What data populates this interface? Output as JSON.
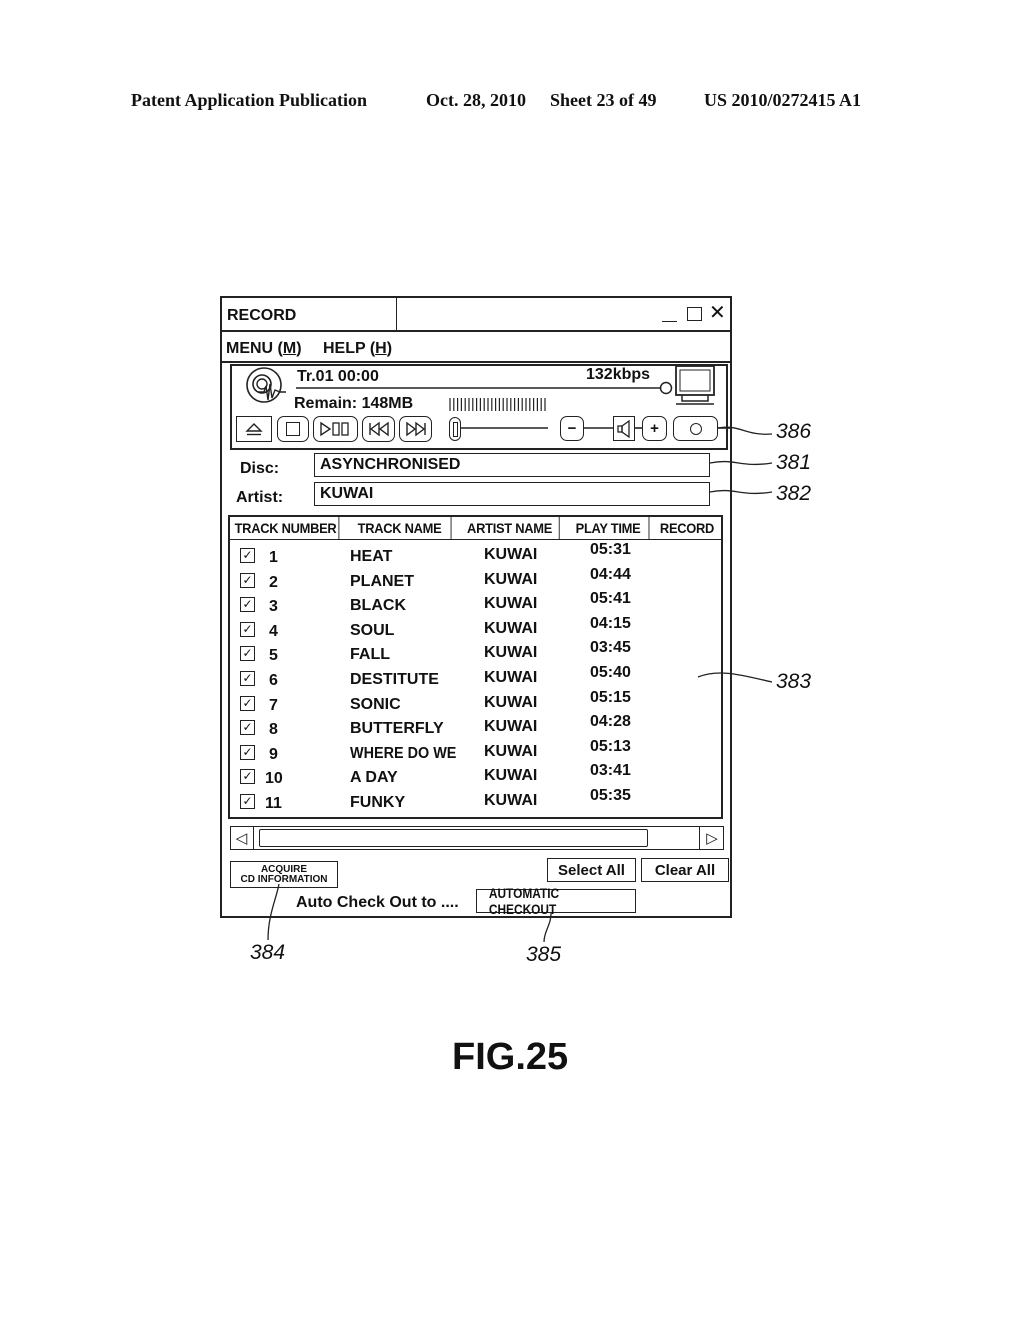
{
  "page_header": {
    "publication": "Patent Application Publication",
    "date": "Oct. 28, 2010",
    "sheet": "Sheet 23 of 49",
    "patent_number": "US 2010/0272415 A1"
  },
  "window": {
    "title": "RECORD",
    "controls": {
      "minimize": "_",
      "maximize": "□",
      "close": "✕"
    },
    "menu": [
      {
        "label": "MENU (",
        "mnemonic": "M",
        "suffix": ")"
      },
      {
        "label": "HELP (",
        "mnemonic": "H",
        "suffix": ")"
      }
    ]
  },
  "player": {
    "track_time": "Tr.01  00:00",
    "bitrate": "132kbps",
    "remain": "Remain:  148MB",
    "buttons": {
      "eject": "⏏",
      "stop": "□",
      "play_pause": "▷▯▯",
      "previous": "⏮",
      "next": "⏭",
      "volume_down": "−",
      "speaker": "speaker",
      "volume_up": "+",
      "record": "○"
    }
  },
  "disc": {
    "label": "Disc:",
    "value": "ASYNCHRONISED"
  },
  "artist": {
    "label": "Artist:",
    "value": "KUWAI"
  },
  "table": {
    "columns": [
      "TRACK NUMBER",
      "TRACK NAME",
      "ARTIST NAME",
      "PLAY TIME",
      "RECORD"
    ],
    "rows": [
      {
        "checked": true,
        "number": "1",
        "name": "HEAT",
        "artist": "KUWAI",
        "time": "05:31"
      },
      {
        "checked": true,
        "number": "2",
        "name": "PLANET",
        "artist": "KUWAI",
        "time": "04:44"
      },
      {
        "checked": true,
        "number": "3",
        "name": "BLACK",
        "artist": "KUWAI",
        "time": "05:41"
      },
      {
        "checked": true,
        "number": "4",
        "name": "SOUL",
        "artist": "KUWAI",
        "time": "04:15"
      },
      {
        "checked": true,
        "number": "5",
        "name": "FALL",
        "artist": "KUWAI",
        "time": "03:45"
      },
      {
        "checked": true,
        "number": "6",
        "name": "DESTITUTE",
        "artist": "KUWAI",
        "time": "05:40"
      },
      {
        "checked": true,
        "number": "7",
        "name": "SONIC",
        "artist": "KUWAI",
        "time": "05:15"
      },
      {
        "checked": true,
        "number": "8",
        "name": "BUTTERFLY",
        "artist": "KUWAI",
        "time": "04:28"
      },
      {
        "checked": true,
        "number": "9",
        "name": "WHERE DO WE",
        "artist": "KUWAI",
        "time": "05:13"
      },
      {
        "checked": true,
        "number": "10",
        "name": "A DAY",
        "artist": "KUWAI",
        "time": "03:41"
      },
      {
        "checked": true,
        "number": "11",
        "name": "FUNKY",
        "artist": "KUWAI",
        "time": "05:35"
      }
    ],
    "checkmark": "✓"
  },
  "scrollbar": {
    "left_arrow": "◁",
    "right_arrow": "▷"
  },
  "actions": {
    "acquire_line1": "ACQUIRE",
    "acquire_line2": "CD INFORMATION",
    "select_all": "Select All",
    "clear_all": "Clear All",
    "auto_checkout_label": "Auto Check Out to ....",
    "automatic_checkout": "AUTOMATIC CHECKOUT"
  },
  "callouts": {
    "c386": "386",
    "c381": "381",
    "c382": "382",
    "c383": "383",
    "c384": "384",
    "c385": "385"
  },
  "figure_label": "FIG.25"
}
